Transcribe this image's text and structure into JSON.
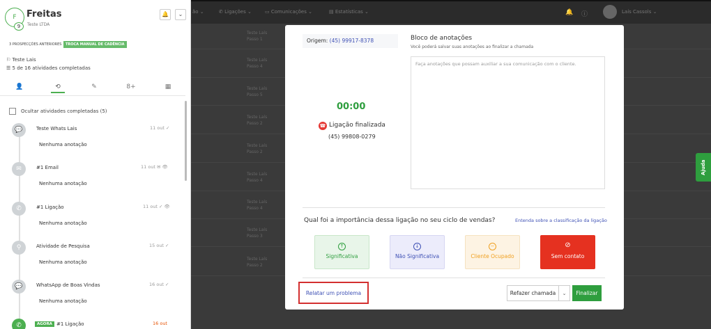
{
  "lead": {
    "initial": "F",
    "badge": "9",
    "name": "Freitas",
    "company": "Teste LTDA",
    "tags": [
      "3 PROSPECÇÕES ANTERIORES",
      "TROCA MANUAL DE CADÊNCIA"
    ],
    "owner": "Teste Lais",
    "progress_text": "5 de 16 atividades completadas"
  },
  "header_buttons": {
    "bell": "🔔",
    "caret": "⌄"
  },
  "tab_icons": [
    "👤",
    "⟲",
    "✎",
    "8+",
    "▦"
  ],
  "hide_completed_label": "Ocultar atividades completadas (5)",
  "activities": [
    {
      "icon": "💬",
      "title": "Teste Whats Lais",
      "date": "11 out ✓",
      "note": "Nenhuma anotação"
    },
    {
      "icon": "✉",
      "title": "#1 Email",
      "date": "11 out ✉ 👁",
      "note": "Nenhuma anotação"
    },
    {
      "icon": "✆",
      "title": "#1 Ligação",
      "date": "11 out ✓ 👁",
      "note": "Nenhuma anotação"
    },
    {
      "icon": "⚲",
      "title": "Atividade de Pesquisa",
      "date": "15 out ✓",
      "note": "Nenhuma anotação"
    },
    {
      "icon": "💬",
      "title": "WhatsApp de Boas Vindas",
      "date": "16 out ✓",
      "note": "Nenhuma anotação"
    },
    {
      "icon": "✆",
      "title": "#1 Ligação",
      "date": "16 out",
      "note": "",
      "badge": "AGORA"
    }
  ],
  "topbar": {
    "items": [
      "ão ⌄",
      "Ligações ⌄",
      "Comunicações ⌄",
      "Estatísticas ⌄"
    ],
    "user": "Laís Cassols ⌄"
  },
  "bg_rows": [
    {
      "title": "Teste Laís",
      "sub": "Passo 1"
    },
    {
      "title": "Teste Laís",
      "sub": "Passo 4"
    },
    {
      "title": "Teste Laís",
      "sub": "Passo 5"
    },
    {
      "title": "Teste Laís",
      "sub": "Passo 2"
    },
    {
      "title": "Teste Laís",
      "sub": "Passo 2"
    },
    {
      "title": "Teste Laís",
      "sub": "Passo 4"
    },
    {
      "title": "Teste Laís",
      "sub": "Passo 4"
    },
    {
      "title": "Teste Laís",
      "sub": "Passo 3"
    },
    {
      "title": "Teste Laís",
      "sub": "Passo 2"
    }
  ],
  "help_label": "Ajuda",
  "modal": {
    "origin_label": "Origem:",
    "origin_number": "(45) 99917-8378",
    "timer": "00:00",
    "status_text": "Ligação finalizada",
    "dest_number": "(45) 99808-0279",
    "notes_title": "Bloco de anotações",
    "notes_subtitle": "Você poderá salvar suas anotações ao finalizar a chamada",
    "notes_placeholder": "Faça anotações que possam auxiliar a sua comunicação com o cliente.",
    "question": "Qual foi a importância dessa ligação no seu ciclo de vendas?",
    "question_link": "Entenda sobre a classificação da ligação",
    "classifications": [
      {
        "label": "Significativa",
        "icon": "↑",
        "bg": "#e8f5e9",
        "border": "#c8e6c9",
        "color": "#2e9e3e"
      },
      {
        "label": "Não Significativa",
        "icon": "↓",
        "bg": "#ececfb",
        "border": "#d6d6f2",
        "color": "#3f51b5"
      },
      {
        "label": "Cliente Ocupado",
        "icon": "−",
        "bg": "#fdf3e3",
        "border": "#f5e2c0",
        "color": "#f0a020"
      },
      {
        "label": "Sem contato",
        "icon": "⊘",
        "bg": "#e53120",
        "border": "#e53120",
        "color": "#ffffff"
      }
    ],
    "report_label": "Relatar um problema",
    "redo_label": "Refazer chamada",
    "redo_caret": "⌄",
    "finish_label": "Finalizar"
  }
}
